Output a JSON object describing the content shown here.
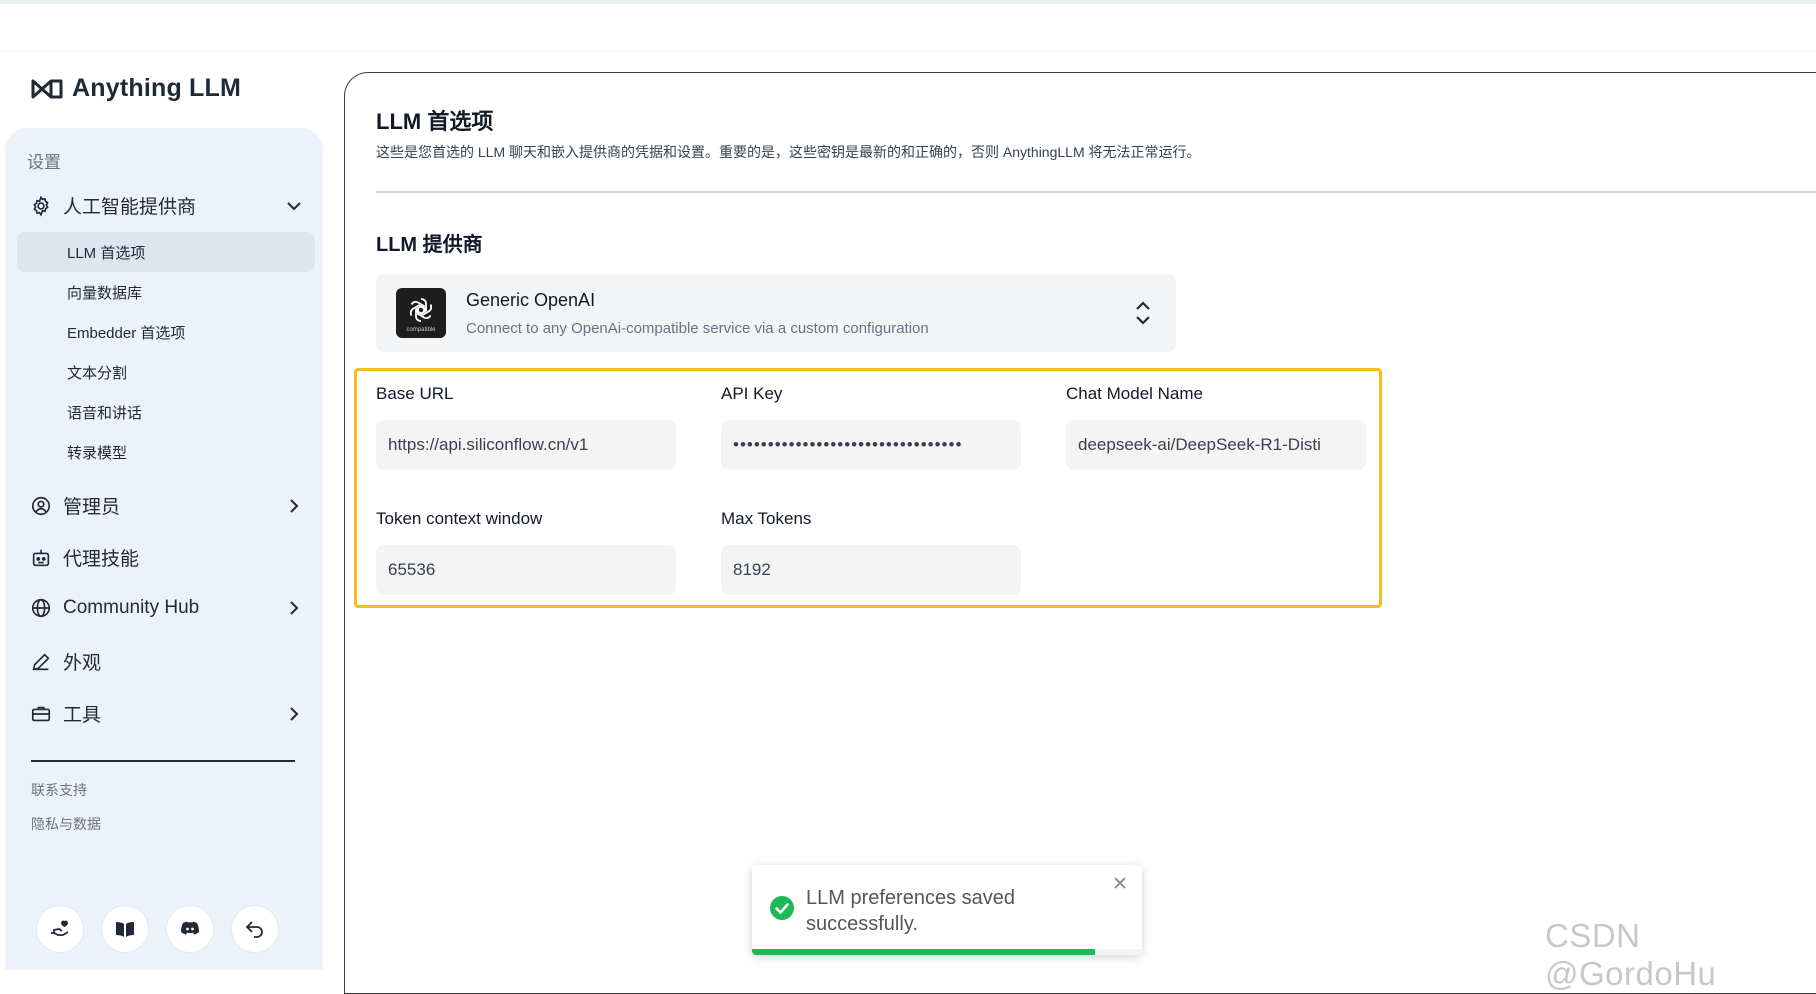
{
  "app": {
    "brand": "Anything LLM"
  },
  "sidebar": {
    "section_label": "设置",
    "ai_providers": {
      "label": "人工智能提供商",
      "items": [
        "LLM 首选项",
        "向量数据库",
        "Embedder 首选项",
        "文本分割",
        "语音和讲话",
        "转录模型"
      ],
      "active": "LLM 首选项"
    },
    "admin": "管理员",
    "agent_skills": "代理技能",
    "community_hub": "Community Hub",
    "appearance": "外观",
    "tools": "工具",
    "footer_links": [
      "联系支持",
      "隐私与数据"
    ]
  },
  "main": {
    "title": "LLM 首选项",
    "description": "这些是您首选的 LLM 聊天和嵌入提供商的凭据和设置。重要的是，这些密钥是最新的和正确的，否则 AnythingLLM 将无法正常运行。",
    "provider_section": "LLM 提供商",
    "provider": {
      "name": "Generic OpenAI",
      "description": "Connect to any OpenAi-compatible service via a custom configuration",
      "logo_caption": "compatible"
    },
    "fields": {
      "base_url": {
        "label": "Base URL",
        "value": "https://api.siliconflow.cn/v1"
      },
      "api_key": {
        "label": "API Key",
        "value": "•••••••••••••••••••••••••••••••••"
      },
      "chat_model": {
        "label": "Chat Model Name",
        "value": "deepseek-ai/DeepSeek-R1-Disti"
      },
      "token_window": {
        "label": "Token context window",
        "value": "65536"
      },
      "max_tokens": {
        "label": "Max Tokens",
        "value": "8192"
      }
    }
  },
  "toast": {
    "message": "LLM preferences saved successfully.",
    "progress": 0.88,
    "color": "#1db954"
  },
  "watermark": "CSDN @GordoHu",
  "colors": {
    "highlight": "#f5bd1f",
    "sidebar_bg": "#edf2fa"
  }
}
